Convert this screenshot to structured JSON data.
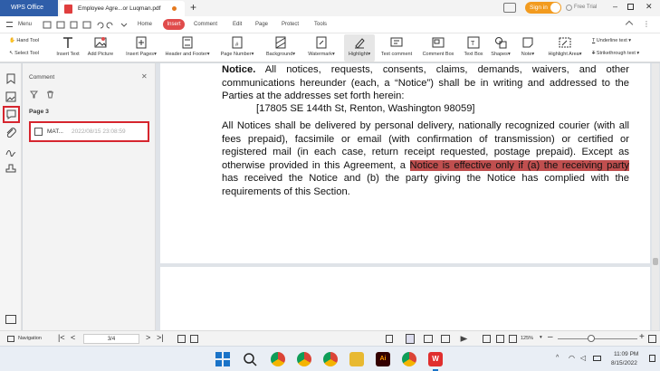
{
  "titlebar": {
    "app_tab": "WPS Office",
    "doc_tab": "Employee Agre...or Luqman.pdf",
    "sign_in": "Sign in",
    "free_trial": "Free Trial"
  },
  "menu": {
    "hamburger": "Menu",
    "items": [
      "Home",
      "Insert",
      "Comment",
      "Edit",
      "Page",
      "Protect",
      "Tools"
    ],
    "active": "Insert"
  },
  "ribbon": {
    "hand_tool": "Hand Tool",
    "select_tool": "Select Tool",
    "insert_text": "Insert Text",
    "add_picture": "Add Picture",
    "insert_pages": "Insert Pages",
    "header_footer": "Header and Footer",
    "page_number": "Page Number",
    "background": "Background",
    "watermark": "Watermark",
    "highlight": "Highlight",
    "text_comment": "Text comment",
    "comment_box": "Comment Box",
    "text_box": "Text Box",
    "shapes": "Shapes",
    "note": "Note",
    "highlight_area": "Highlight Area",
    "underline_text": "Underline text",
    "strikethrough_text": "Strikethrough text"
  },
  "comment_panel": {
    "title": "Comment",
    "page_label": "Page 3",
    "item_author": "MAT...",
    "item_date": "2022/08/15 23:08:59"
  },
  "document": {
    "notice_heading": "Notice.",
    "p1_rest": " All notices, requests, consents, claims, demands, waivers, and other communications hereunder (each, a “Notice”) shall be in writing and addressed to the Parties at the addresses set forth herein:",
    "address": "[17805 SE 144th St, Renton, Washington 98059]",
    "p2_before": "All Notices shall be delivered by personal delivery, nationally recognized courier (with all fees prepaid), facsimile or email (with confirmation of transmission) or certified or registered mail (in each case, return receipt requested, postage prepaid). Except as otherwise provided in this Agreement, a ",
    "p2_highlight": "Notice is effective only if (a) the receiving party",
    "p2_after": " has received the Notice and (b) the party giving the Notice has complied with the requirements of this Section."
  },
  "status": {
    "navigation": "Navigation",
    "page_indicator": "3/4",
    "zoom": "125%"
  },
  "taskbar": {
    "time": "11:09 PM",
    "date": "8/15/2022"
  },
  "colors": {
    "accent_red": "#d6252e",
    "highlight": "#c04f4f",
    "wps_blue": "#2f5ea9",
    "signin_orange": "#f29b1f"
  }
}
